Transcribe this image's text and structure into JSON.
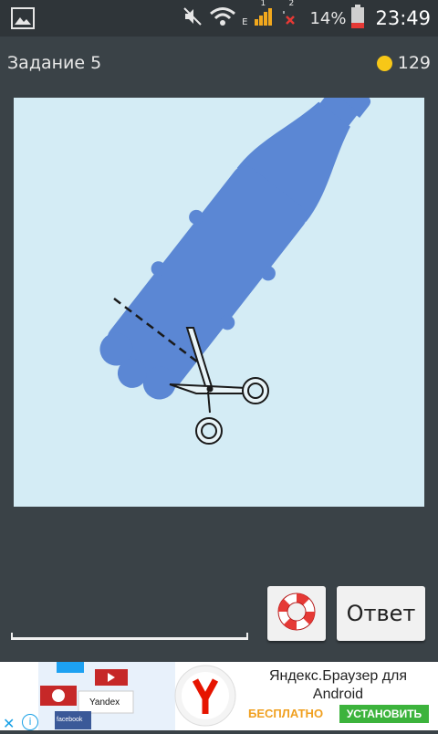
{
  "status_bar": {
    "battery_percent": "14%",
    "time": "23:49",
    "network_type": "E",
    "sim1_label": "1",
    "sim2_label": "2",
    "icons": [
      "gallery-icon",
      "mute-icon",
      "wifi-icon",
      "signal-icon",
      "battery-icon"
    ]
  },
  "header": {
    "task_title": "Задание 5",
    "coin_count": "129",
    "coin_color": "#f7c717"
  },
  "puzzle": {
    "background": "#d4ecf5",
    "bottle_color": "#5b87d4",
    "icons": [
      "bottle-icon",
      "scissors-icon",
      "cut-line"
    ]
  },
  "controls": {
    "answer_label": "Ответ",
    "hint_icon": "lifebuoy-icon"
  },
  "ad": {
    "title": "Яндекс.Браузер для Android",
    "free_label": "БЕСПЛАТНО",
    "install_label": "УСТАНОВИТЬ",
    "art_labels": {
      "yandex": "Yandex",
      "facebook": "facebook"
    },
    "close_icon": "close-icon",
    "info_icon": "info-icon"
  }
}
